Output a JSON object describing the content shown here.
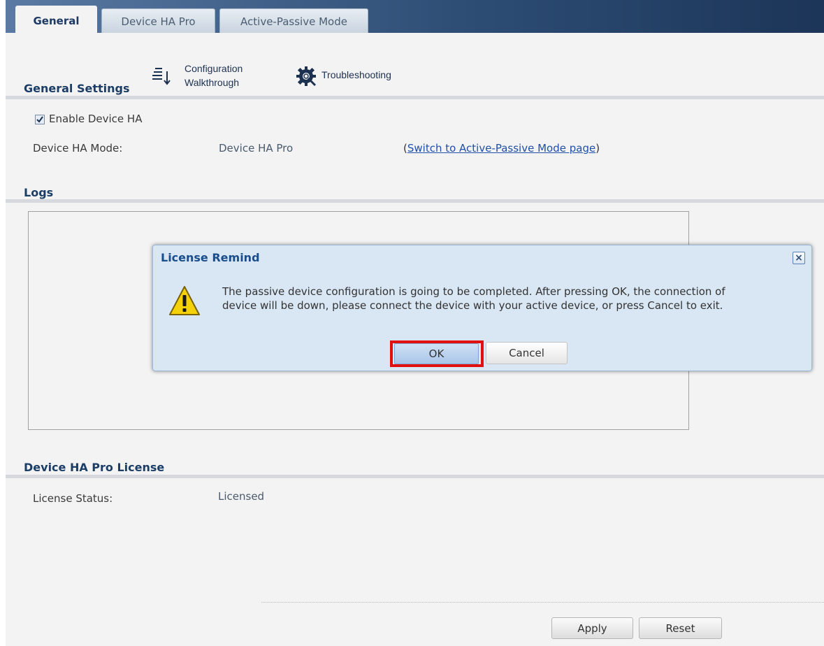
{
  "tabs": [
    {
      "label": "General",
      "active": true
    },
    {
      "label": "Device HA Pro",
      "active": false
    },
    {
      "label": "Active-Passive Mode",
      "active": false
    }
  ],
  "general_settings": {
    "title": "General Settings",
    "config_walkthrough": {
      "line1": "Configuration",
      "line2": "Walkthrough",
      "icon": "list-sort-icon"
    },
    "troubleshooting": {
      "label": "Troubleshooting",
      "icon": "gear-search-icon"
    },
    "enable_device_ha": {
      "label": "Enable Device HA",
      "checked": true
    },
    "device_ha_mode": {
      "label": "Device HA Mode:",
      "value": "Device HA Pro",
      "link_open": "(",
      "link_text": "Switch to Active-Passive Mode page",
      "link_close": ")"
    }
  },
  "logs": {
    "title": "Logs"
  },
  "license": {
    "title": "Device HA Pro License",
    "status_label": "License Status:",
    "status_value": "Licensed"
  },
  "footer": {
    "apply": "Apply",
    "reset": "Reset"
  },
  "dialog": {
    "title": "License Remind",
    "close": "×",
    "message_line1": "The passive device configuration is going to be completed. After pressing OK, the connection of",
    "message_line2": "device will be down, please connect the device with your active device, or press Cancel to exit.",
    "ok": "OK",
    "cancel": "Cancel",
    "icon": "warning-icon"
  },
  "colors": {
    "accent": "#1b3d66",
    "link": "#1f4fa8",
    "highlight": "#e01010",
    "dialog_bg": "#d9e6f3"
  }
}
